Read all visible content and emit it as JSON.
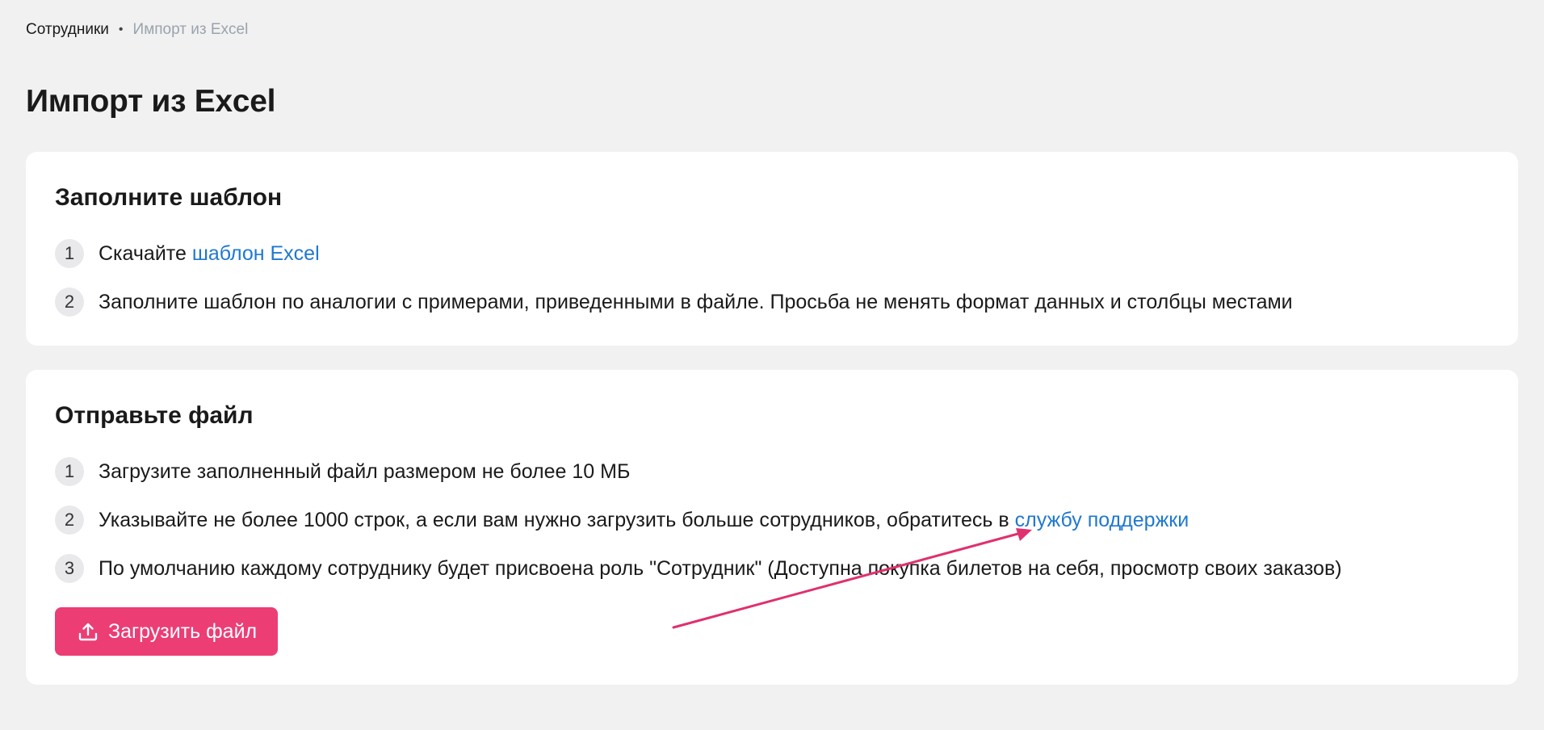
{
  "breadcrumb": {
    "parent": "Сотрудники",
    "separator": "•",
    "current": "Импорт из Excel"
  },
  "page_title": "Импорт из Excel",
  "template_card": {
    "title": "Заполните шаблон",
    "steps": [
      {
        "number": "1",
        "text": "Скачайте ",
        "link": "шаблон Excel"
      },
      {
        "number": "2",
        "text": "Заполните шаблон по аналогии с примерами, приведенными в файле. Просьба не менять формат данных и столбцы местами"
      }
    ]
  },
  "upload_card": {
    "title": "Отправьте файл",
    "steps": [
      {
        "number": "1",
        "text": "Загрузите заполненный файл размером не более 10 МБ"
      },
      {
        "number": "2",
        "text": "Указывайте не более 1000 строк, а если вам нужно загрузить больше сотрудников, обратитесь в ",
        "link": "службу поддержки"
      },
      {
        "number": "3",
        "text": "По умолчанию каждому сотруднику будет присвоена роль \"Сотрудник\" (Доступна покупка билетов на себя, просмотр своих заказов)"
      }
    ],
    "button": {
      "label": "Загрузить файл",
      "icon": "upload-icon"
    }
  },
  "colors": {
    "background": "#f1f1f1",
    "card": "#ffffff",
    "link": "#1f78d1",
    "accent_button": "#ec3d75",
    "annotation_arrow": "#e0306e",
    "muted_text": "#9aa3ad"
  }
}
